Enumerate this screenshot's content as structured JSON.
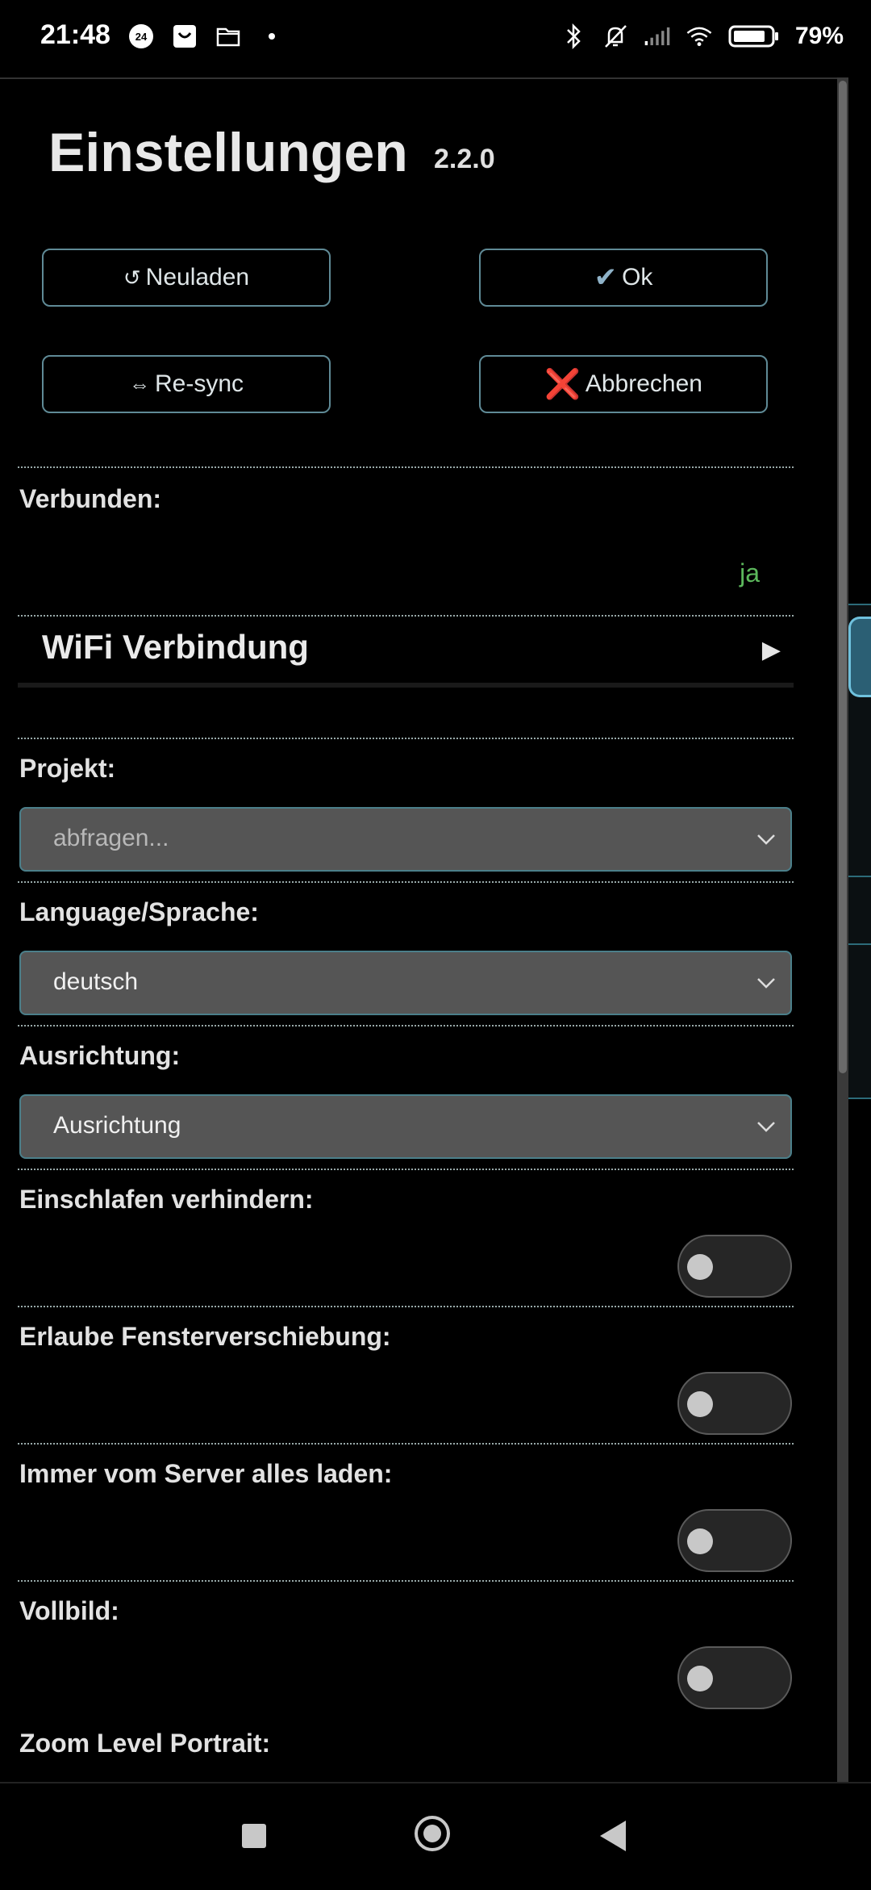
{
  "status_bar": {
    "time": "21:48",
    "left_icons": [
      "calendar-24-icon",
      "shopping-bag-icon",
      "folder-icon",
      "dot-icon"
    ],
    "right_icons": [
      "bluetooth-icon",
      "silent-bell-icon",
      "signal-icon",
      "wifi-icon",
      "battery-icon"
    ],
    "battery": "79%"
  },
  "header": {
    "title": "Einstellungen",
    "version": "2.2.0"
  },
  "buttons": {
    "reload_icon": "↺",
    "reload": "Neuladen",
    "ok_icon": "✔",
    "ok": "Ok",
    "resync_icon": "⇔",
    "resync": "Re-sync",
    "cancel_icon": "❌",
    "cancel": "Abbrechen"
  },
  "connected": {
    "label": "Verbunden:",
    "value": "ja"
  },
  "wifi": {
    "title": "WiFi Verbindung",
    "arrow": "▶"
  },
  "project": {
    "label": "Projekt:",
    "placeholder": "abfragen..."
  },
  "language": {
    "label": "Language/Sprache:",
    "value": "deutsch"
  },
  "orientation": {
    "label": "Ausrichtung:",
    "value": "Ausrichtung"
  },
  "toggles": [
    {
      "label": "Einschlafen verhindern:",
      "on": false
    },
    {
      "label": "Erlaube Fensterverschiebung:",
      "on": false
    },
    {
      "label": "Immer vom Server alles laden:",
      "on": false
    },
    {
      "label": "Vollbild:",
      "on": false
    }
  ],
  "zoom": {
    "label": "Zoom Level Portrait:"
  },
  "colors": {
    "accent_border": "#5f8a96",
    "connected_green": "#5cb85c",
    "select_bg": "#555555"
  }
}
